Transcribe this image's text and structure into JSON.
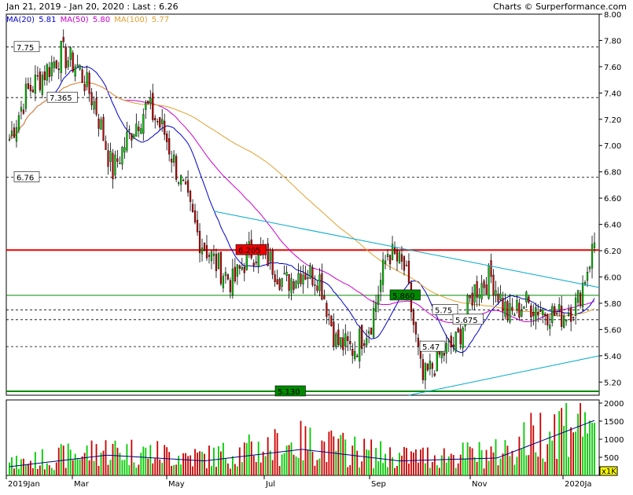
{
  "header": {
    "title": "Jan 21, 2019 - Jan 20, 2020 : Last : 6.26",
    "source": "Charts © Surperformance.com"
  },
  "legend": {
    "ma20_label": "MA(20)",
    "ma20_value": "5.81",
    "ma50_label": "MA(50)",
    "ma50_value": "5.80",
    "ma100_label": "MA(100)",
    "ma100_value": "5.77"
  },
  "colors": {
    "up": "#00cc00",
    "down": "#cc0000",
    "ma20": "#0000cc",
    "ma50": "#cc00cc",
    "ma100": "#e0a030",
    "trend": "#00aacc",
    "resistance": "#ee0000",
    "support": "#008800",
    "volume_avg": "#000080"
  },
  "chart_data": {
    "type": "candlestick",
    "price_axis": {
      "ylim": [
        5.1,
        8.0
      ],
      "ticks": [
        "8.00",
        "7.80",
        "7.60",
        "7.40",
        "7.20",
        "7.00",
        "6.80",
        "6.60",
        "6.40",
        "6.20",
        "6.00",
        "5.80",
        "5.60",
        "5.40",
        "5.20"
      ]
    },
    "volume_axis": {
      "ylim": [
        0,
        2000
      ],
      "ticks": [
        "2000",
        "1500",
        "1000",
        "500"
      ],
      "unit": "x1K"
    },
    "x_labels": [
      "2019Jan",
      "Mar",
      "May",
      "Jul",
      "Sep",
      "Nov",
      "2020Ja"
    ],
    "levels": [
      {
        "label": "7.75",
        "value": 7.75,
        "style": "dashed"
      },
      {
        "label": "7.365",
        "value": 7.365,
        "style": "dashed"
      },
      {
        "label": "6.76",
        "value": 6.76,
        "style": "dashed"
      },
      {
        "label": "6.205",
        "value": 6.205,
        "style": "resistance"
      },
      {
        "label": "5.860",
        "value": 5.86,
        "style": "support-box"
      },
      {
        "label": "5.75",
        "value": 5.75,
        "style": "dashed"
      },
      {
        "label": "5.675",
        "value": 5.675,
        "style": "dashed"
      },
      {
        "label": "5.47",
        "value": 5.47,
        "style": "dashed"
      },
      {
        "label": "5.130",
        "value": 5.13,
        "style": "support"
      }
    ],
    "trendlines": [
      {
        "from": [
          "Jun",
          "6.50"
        ],
        "to": [
          "2020Ja",
          "5.92"
        ]
      },
      {
        "from": [
          "Sep",
          "5.10"
        ],
        "to": [
          "2020Ja",
          "5.40"
        ]
      }
    ],
    "price_path": [
      [
        "2019Jan",
        7.05
      ],
      [
        "Jan-2",
        7.4
      ],
      [
        "Feb",
        7.55
      ],
      [
        "Feb-2",
        7.7
      ],
      [
        "Mar",
        7.6
      ],
      [
        "Mar-2",
        7.3
      ],
      [
        "Mar-3",
        6.8
      ],
      [
        "Apr",
        7.1
      ],
      [
        "Apr-2",
        7.3
      ],
      [
        "Apr-3",
        7.1
      ],
      [
        "May",
        6.7
      ],
      [
        "May-2",
        6.3
      ],
      [
        "May-3",
        6.1
      ],
      [
        "Jun",
        5.95
      ],
      [
        "Jun-2",
        6.2
      ],
      [
        "Jun-3",
        6.15
      ],
      [
        "Jul",
        5.95
      ],
      [
        "Jul-2",
        6.05
      ],
      [
        "Jul-3",
        6.0
      ],
      [
        "Aug",
        5.5
      ],
      [
        "Aug-2",
        5.45
      ],
      [
        "Aug-3",
        5.65
      ],
      [
        "Sep",
        6.2
      ],
      [
        "Sep-2",
        6.05
      ],
      [
        "Sep-3",
        5.2
      ],
      [
        "Oct",
        5.4
      ],
      [
        "Oct-2",
        5.5
      ],
      [
        "Oct-3",
        5.9
      ],
      [
        "Nov",
        6.0
      ],
      [
        "Nov-2",
        5.7
      ],
      [
        "Nov-3",
        5.8
      ],
      [
        "Dec",
        5.75
      ],
      [
        "Dec-2",
        5.7
      ],
      [
        "Dec-3",
        5.8
      ],
      [
        "2020Ja",
        6.26
      ]
    ],
    "volume_path": [
      [
        "2019Jan",
        300
      ],
      [
        "Mar",
        700
      ],
      [
        "May",
        500
      ],
      [
        "Jul",
        900
      ],
      [
        "Sep",
        500
      ],
      [
        "Nov",
        600
      ],
      [
        "2020Ja",
        1900
      ]
    ]
  }
}
